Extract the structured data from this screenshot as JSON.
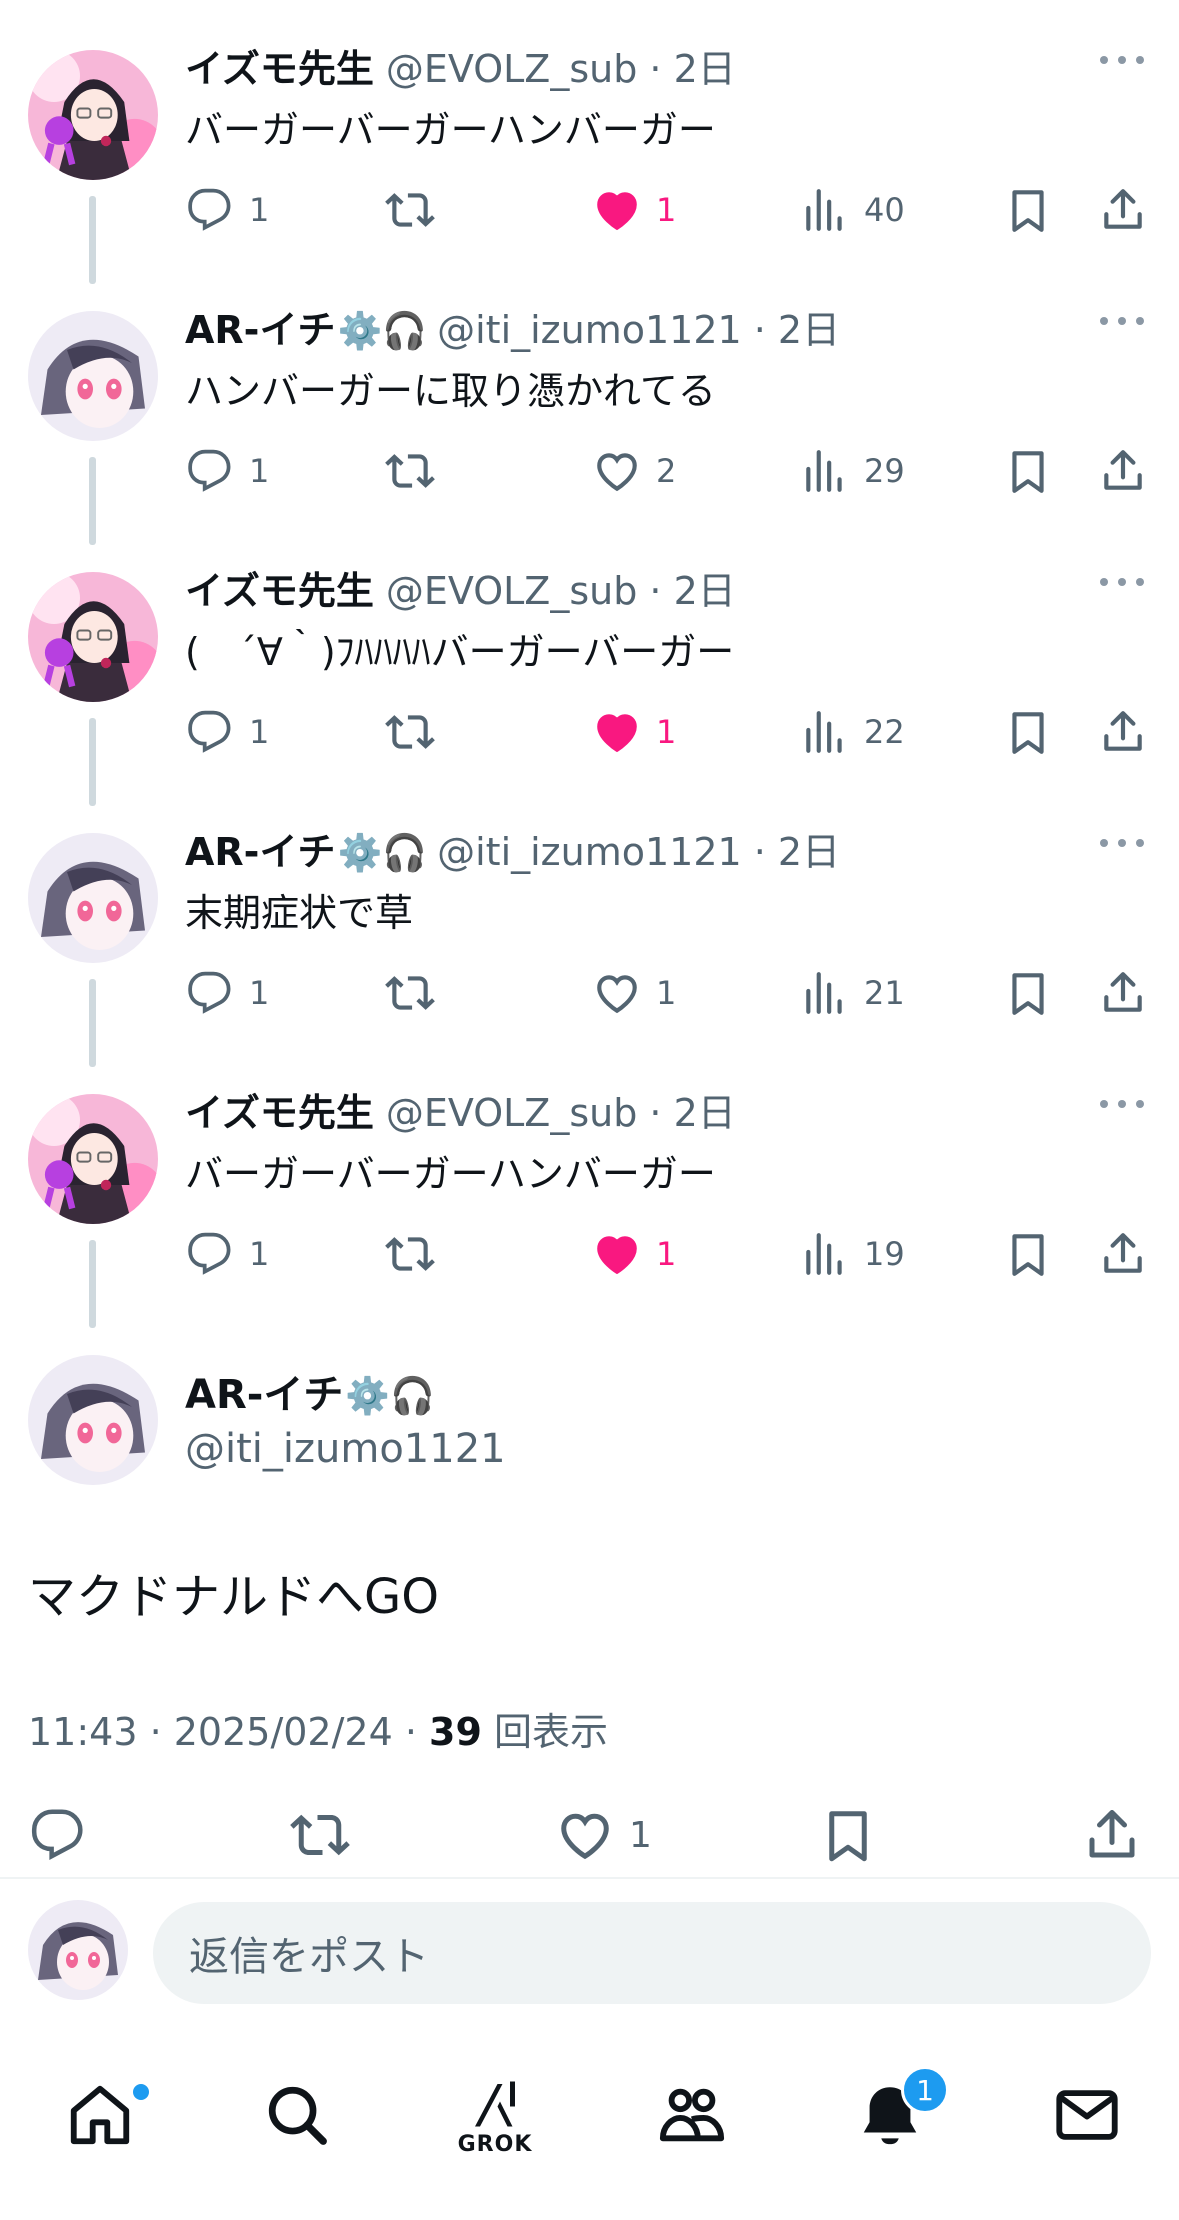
{
  "thread": [
    {
      "name": "イズモ先生",
      "badges": "",
      "handle": "@EVOLZ_sub · 2日",
      "text": "バーガーバーガーハンバーガー",
      "replies": "1",
      "retweets": "",
      "likes": "1",
      "liked": true,
      "views": "40"
    },
    {
      "name": "AR-イチ",
      "badges": "⚙️🎧",
      "handle": "@iti_izumo1121 · 2日",
      "text": "ハンバーガーに取り憑かれてる",
      "replies": "1",
      "retweets": "",
      "likes": "2",
      "liked": false,
      "views": "29"
    },
    {
      "name": "イズモ先生",
      "badges": "",
      "handle": "@EVOLZ_sub · 2日",
      "text": "(　´∀｀)ﾌﾊﾊﾊﾊバーガーバーガー",
      "replies": "1",
      "retweets": "",
      "likes": "1",
      "liked": true,
      "views": "22"
    },
    {
      "name": "AR-イチ",
      "badges": "⚙️🎧",
      "handle": "@iti_izumo1121 · 2日",
      "text": "末期症状で草",
      "replies": "1",
      "retweets": "",
      "likes": "1",
      "liked": false,
      "views": "21"
    },
    {
      "name": "イズモ先生",
      "badges": "",
      "handle": "@EVOLZ_sub · 2日",
      "text": "バーガーバーガーハンバーガー",
      "replies": "1",
      "retweets": "",
      "likes": "1",
      "liked": true,
      "views": "19"
    }
  ],
  "main": {
    "name": "AR-イチ",
    "badges": "⚙️🎧",
    "handle": "@iti_izumo1121",
    "text": "マクドナルドへGO",
    "time": "11:43 · 2025/02/24 · ",
    "views_count": "39",
    "views_label": " 回表示",
    "likes": "1"
  },
  "reply": {
    "placeholder": "返信をポスト"
  },
  "tabbar": {
    "grok_label": "GROK",
    "notif_count": "1"
  },
  "colors": {
    "like": "#f91880",
    "accent": "#1d9bf0",
    "muted": "#536471"
  },
  "icons": [
    "reply-icon",
    "retweet-icon",
    "heart-icon",
    "views-icon",
    "bookmark-icon",
    "share-icon",
    "home-icon",
    "search-icon",
    "grok-icon",
    "communities-icon",
    "notifications-icon",
    "messages-icon"
  ]
}
